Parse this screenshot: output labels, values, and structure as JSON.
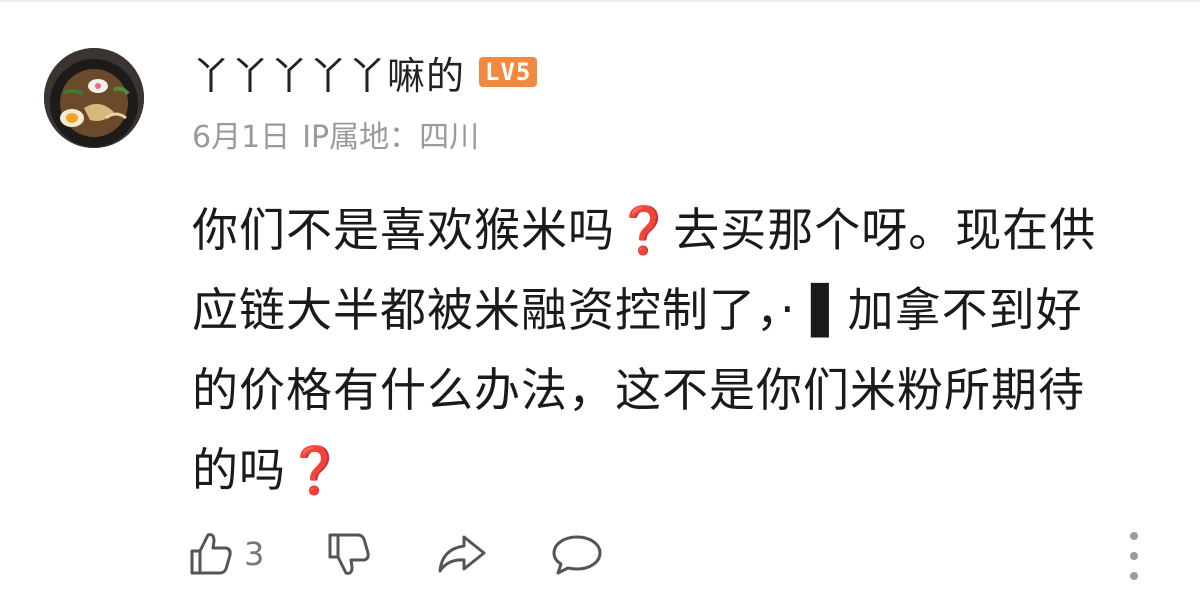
{
  "comment": {
    "username": "丫丫丫丫丫嘛的",
    "level_badge": "LV5",
    "date": "6月1日",
    "ip_location": "IP属地：四川",
    "body_lines": [
      "你们不是喜欢猴米吗❓去买那个呀。现在供",
      "应链大半都被米融资控制了，‧ ▌加拿不到好",
      "的价格有什么办法，这不是你们米粉所期待",
      "的吗❓"
    ],
    "like_count": "3"
  },
  "icons": {
    "like": "thumbs-up-icon",
    "dislike": "thumbs-down-icon",
    "share": "share-arrow-icon",
    "reply": "comment-bubble-icon",
    "more": "more-vertical-icon"
  },
  "colors": {
    "badge": "#f08a3e",
    "question_mark": "#e23b3b",
    "meta": "#9a9a9a"
  }
}
